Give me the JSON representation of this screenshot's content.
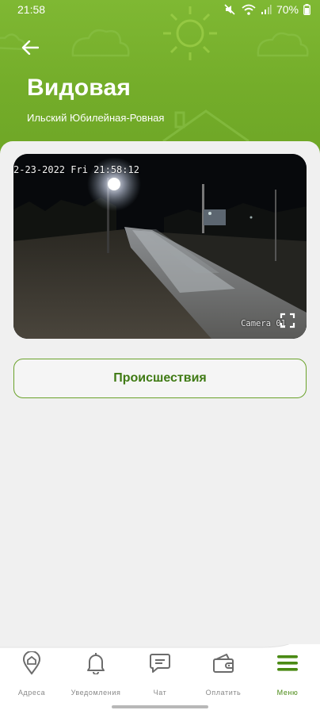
{
  "status_bar": {
    "time": "21:58",
    "battery": "70%"
  },
  "header": {
    "title": "Видовая",
    "subtitle": "Ильский Юбилейная-Ровная"
  },
  "camera": {
    "timestamp": "2-23-2022 Fri 21:58:12",
    "label": "Camera 01"
  },
  "actions": {
    "incidents_label": "Происшествия"
  },
  "nav": {
    "items": [
      {
        "label": "Адреса",
        "icon": "location-pin-icon"
      },
      {
        "label": "Уведомления",
        "icon": "bell-icon"
      },
      {
        "label": "Чат",
        "icon": "chat-icon"
      },
      {
        "label": "Оплатить",
        "icon": "wallet-icon"
      },
      {
        "label": "Меню",
        "icon": "menu-icon",
        "active": true
      }
    ]
  },
  "colors": {
    "brand_green": "#74ad2a",
    "accent_dark_green": "#3f7a14",
    "nav_active": "#4a8a14",
    "nav_inactive": "#888888"
  }
}
